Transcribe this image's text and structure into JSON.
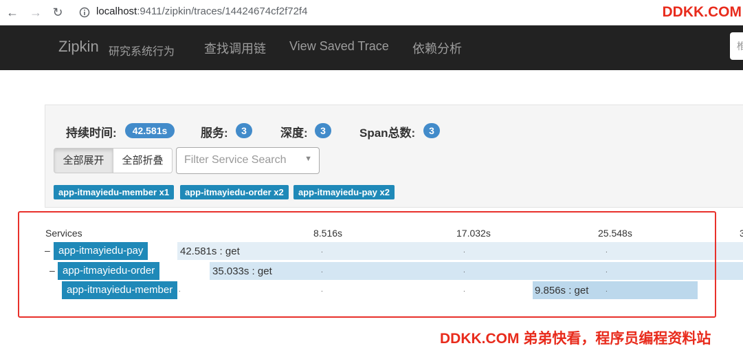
{
  "browser": {
    "back_icon": "arrow-left-icon",
    "forward_icon": "arrow-right-icon",
    "reload_icon": "reload-icon",
    "info_icon": "info-icon",
    "url_host": "localhost",
    "url_path": ":9411/zipkin/traces/14424674cf2f72f4",
    "watermark": "DDKK.COM"
  },
  "navbar": {
    "brand": "Zipkin",
    "brand_sub": "研究系统行为",
    "items": [
      "查找调用链",
      "View Saved Trace",
      "依赖分析"
    ],
    "search_partial": "椎"
  },
  "summary": {
    "duration_label": "持续时间:",
    "duration_value": "42.581s",
    "services_label": "服务:",
    "services_value": "3",
    "depth_label": "深度:",
    "depth_value": "3",
    "spans_label": "Span总数:",
    "spans_value": "3",
    "expand_all": "全部展开",
    "collapse_all": "全部折叠",
    "filter_placeholder": "Filter Service Search",
    "service_tags": [
      "app-itmayiedu-member x1",
      "app-itmayiedu-order x2",
      "app-itmayiedu-pay x2"
    ]
  },
  "trace": {
    "services_header": "Services",
    "ticks": [
      "8.516s",
      "17.032s",
      "25.548s",
      "3"
    ],
    "rows": [
      {
        "toggle": "–",
        "service": "app-itmayiedu-pay",
        "label": "42.581s : get",
        "start": 0,
        "duration": 42.581
      },
      {
        "toggle": "–",
        "service": "app-itmayiedu-order",
        "label": "35.033s : get",
        "start": 1.2,
        "duration": 35.033
      },
      {
        "toggle": "",
        "service": "app-itmayiedu-member",
        "label": "9.856s : get",
        "start": 26.0,
        "duration": 9.856
      }
    ],
    "colors": {
      "row_light": "#e3eef6",
      "row_mid": "#d4e6f3",
      "bar_member": "#bcd8ec",
      "service": "#1f89b8"
    }
  },
  "watermark_bottom": "DDKK.COM 弟弟快看，程序员编程资料站"
}
